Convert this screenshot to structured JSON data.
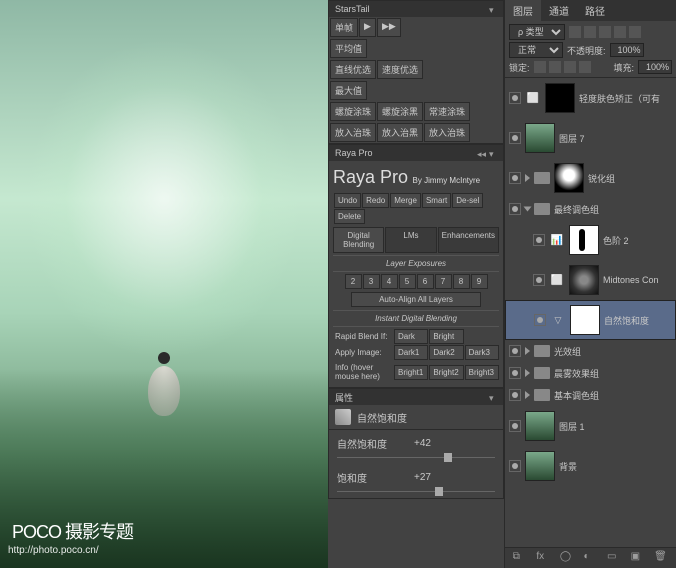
{
  "watermark": {
    "brand": "POCO",
    "sub": "摄影专题",
    "url": "http://photo.poco.cn/"
  },
  "stars": {
    "title": "StarsTail",
    "row1": [
      "单帧",
      "▶",
      "▶▶"
    ],
    "row2": [
      "平均值"
    ],
    "row3": [
      "直线优选",
      "速度优选"
    ],
    "row4": [
      "最大值"
    ],
    "row5": [
      "螺旋涂珠",
      "螺旋涂黑",
      "常速涂珠"
    ],
    "row6": [
      "放入治珠",
      "放入治黑",
      "放入治珠"
    ]
  },
  "raya": {
    "title": "Raya Pro",
    "panel_title": "Raya Pro",
    "byline": "By Jimmy McIntyre",
    "top_row": [
      "Undo",
      "Redo",
      "Merge",
      "Smart",
      "De-sel",
      "Delete"
    ],
    "tabs": [
      "Digital Blending",
      "LMs",
      "Enhancements"
    ],
    "legend1": "Layer Exposures",
    "nums": [
      "2",
      "3",
      "4",
      "5",
      "6",
      "7",
      "8",
      "9"
    ],
    "align": "Auto-Align All Layers",
    "legend2": "Instant Digital Blending",
    "rapid_label": "Rapid Blend If:",
    "rapid": [
      "Dark",
      "Bright"
    ],
    "apply_label": "Apply Image:",
    "info_label": "Info (hover mouse here)",
    "darks": [
      "Dark1",
      "Dark2",
      "Dark3"
    ],
    "brights": [
      "Bright1",
      "Bright2",
      "Bright3"
    ]
  },
  "props": {
    "panel": "属性",
    "adj_name": "自然饱和度",
    "sliders": [
      {
        "name": "自然饱和度",
        "value": "+42",
        "pos": 68
      },
      {
        "name": "饱和度",
        "value": "+27",
        "pos": 62
      }
    ]
  },
  "layers": {
    "tabs": [
      "图层",
      "通道",
      "路径"
    ],
    "kind": "ρ 类型",
    "blend": "正常",
    "opacity_label": "不透明度:",
    "opacity": "100%",
    "lock_label": "锁定:",
    "fill_label": "填充:",
    "fill": "100%",
    "items": [
      {
        "type": "adj",
        "name": "轻度肤色矫正（可有"
      },
      {
        "type": "img",
        "name": "图层 7"
      },
      {
        "type": "group",
        "name": "锐化组",
        "open": false
      },
      {
        "type": "group",
        "name": "最终调色组",
        "open": true
      },
      {
        "type": "adj",
        "name": "色阶 2",
        "indent": 2
      },
      {
        "type": "adj",
        "name": "Midtones Con",
        "indent": 2
      },
      {
        "type": "adj",
        "name": "自然饱和度",
        "indent": 2,
        "selected": true
      },
      {
        "type": "group",
        "name": "光效组",
        "open": false
      },
      {
        "type": "group",
        "name": "晨雾效果组",
        "open": false
      },
      {
        "type": "group",
        "name": "基本调色组",
        "open": false
      },
      {
        "type": "img",
        "name": "图层 1"
      },
      {
        "type": "bg",
        "name": "背景"
      }
    ]
  }
}
